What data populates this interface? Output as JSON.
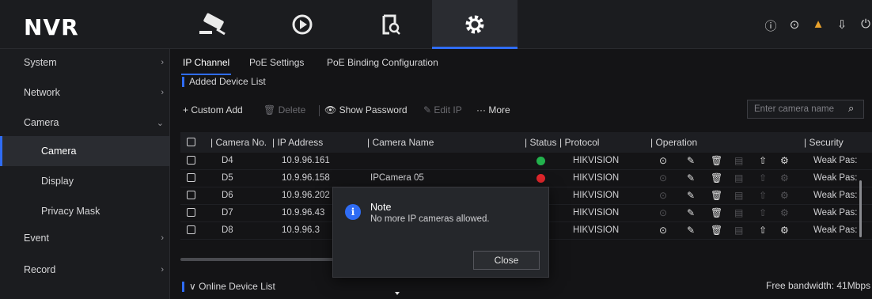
{
  "app": {
    "logo": "NVR"
  },
  "top_nav": {
    "tabs": [
      {
        "icon": "camera-icon",
        "active": false
      },
      {
        "icon": "playback-icon",
        "active": false
      },
      {
        "icon": "search-file-icon",
        "active": false
      },
      {
        "icon": "gear-icon",
        "active": true
      }
    ],
    "right_icons": [
      "info-icon",
      "record-icon",
      "alarm-icon",
      "export-icon",
      "power-icon"
    ]
  },
  "sidebar": {
    "items": [
      {
        "label": "System",
        "chevron": "›"
      },
      {
        "label": "Network",
        "chevron": "›"
      },
      {
        "label": "Camera",
        "chevron": "⌄"
      },
      {
        "label": "Camera",
        "active": true
      },
      {
        "label": "Display"
      },
      {
        "label": "Privacy Mask"
      },
      {
        "label": "Event",
        "chevron": "›"
      },
      {
        "label": "Record",
        "chevron": "›"
      }
    ]
  },
  "sub_tabs": [
    "IP Channel",
    "PoE Settings",
    "PoE Binding Configuration"
  ],
  "added_list_title": "Added Device List",
  "toolbar": {
    "custom_add": "+ Custom Add",
    "delete": "🗑 Delete",
    "show_password": "👁 Show Password",
    "edit_ip": "✎ Edit IP",
    "more": "··· More"
  },
  "search": {
    "placeholder": "Enter camera name",
    "icon": "search-icon"
  },
  "table": {
    "headers": {
      "camera_no": "| Camera No.",
      "ip": "| IP Address",
      "name": "| Camera Name",
      "status": "| Status",
      "protocol": "| Protocol",
      "operation": "| Operation",
      "security": "| Security"
    },
    "rows": [
      {
        "no": "D4",
        "ip": "10.9.96.161",
        "name": "",
        "status": "ok",
        "protocol": "HIKVISION",
        "security": "Weak Pas:"
      },
      {
        "no": "D5",
        "ip": "10.9.96.158",
        "name": "IPCamera 05",
        "status": "error",
        "protocol": "HIKVISION",
        "security": "Weak Pas:"
      },
      {
        "no": "D6",
        "ip": "10.9.96.202",
        "name": "",
        "status": "",
        "protocol": "HIKVISION",
        "security": "Weak Pas:"
      },
      {
        "no": "D7",
        "ip": "10.9.96.43",
        "name": "",
        "status": "",
        "protocol": "HIKVISION",
        "security": "Weak Pas:"
      },
      {
        "no": "D8",
        "ip": "10.9.96.3",
        "name": "",
        "status": "",
        "protocol": "HIKVISION",
        "security": "Weak Pas:"
      }
    ]
  },
  "online_list_title": "∨  Online Device List",
  "free_bandwidth": "Free bandwidth: 41Mbps",
  "dialog": {
    "title": "Note",
    "message": "No more IP cameras allowed.",
    "close_label": "Close",
    "icon": "i"
  },
  "colors": {
    "accent": "#2f6cf4",
    "status_ok": "#22b14c",
    "status_error": "#e0262b"
  }
}
